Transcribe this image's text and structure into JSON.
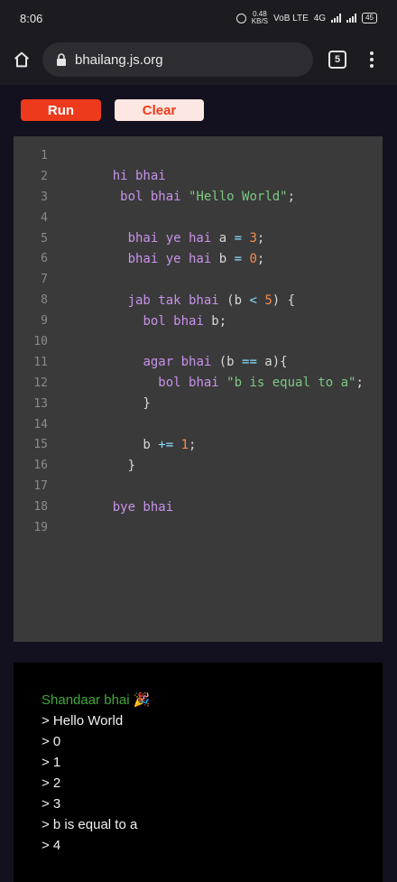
{
  "status_bar": {
    "time": "8:06",
    "speed_top": "0.48",
    "speed_bottom": "KB/S",
    "network_1": "VoB LTE",
    "network_2": "4G",
    "battery": "45"
  },
  "browser": {
    "url": "bhailang.js.org",
    "tab_count": "5"
  },
  "toolbar": {
    "run_label": "Run",
    "clear_label": "Clear"
  },
  "editor": {
    "line_numbers": [
      "1",
      "2",
      "3",
      "4",
      "5",
      "6",
      "7",
      "8",
      "9",
      "10",
      "11",
      "12",
      "13",
      "14",
      "15",
      "16",
      "17",
      "18",
      "19"
    ],
    "code_lines": [
      [],
      [
        {
          "t": "    "
        },
        {
          "t": "hi bhai",
          "c": "kw"
        }
      ],
      [
        {
          "t": "     "
        },
        {
          "t": "bol bhai",
          "c": "kw"
        },
        {
          "t": " "
        },
        {
          "t": "\"Hello World\"",
          "c": "str"
        },
        {
          "t": ";"
        }
      ],
      [],
      [
        {
          "t": "      "
        },
        {
          "t": "bhai ye hai",
          "c": "kw"
        },
        {
          "t": " a "
        },
        {
          "t": "=",
          "c": "op"
        },
        {
          "t": " "
        },
        {
          "t": "3",
          "c": "num"
        },
        {
          "t": ";"
        }
      ],
      [
        {
          "t": "      "
        },
        {
          "t": "bhai ye hai",
          "c": "kw"
        },
        {
          "t": " b "
        },
        {
          "t": "=",
          "c": "op"
        },
        {
          "t": " "
        },
        {
          "t": "0",
          "c": "num"
        },
        {
          "t": ";"
        }
      ],
      [],
      [
        {
          "t": "      "
        },
        {
          "t": "jab tak bhai",
          "c": "kw"
        },
        {
          "t": " (b "
        },
        {
          "t": "<",
          "c": "op"
        },
        {
          "t": " "
        },
        {
          "t": "5",
          "c": "num"
        },
        {
          "t": ") {"
        }
      ],
      [
        {
          "t": "        "
        },
        {
          "t": "bol bhai",
          "c": "kw"
        },
        {
          "t": " b;"
        }
      ],
      [],
      [
        {
          "t": "        "
        },
        {
          "t": "agar bhai",
          "c": "kw"
        },
        {
          "t": " (b "
        },
        {
          "t": "==",
          "c": "op"
        },
        {
          "t": " a){"
        }
      ],
      [
        {
          "t": "          "
        },
        {
          "t": "bol bhai",
          "c": "kw"
        },
        {
          "t": " "
        },
        {
          "t": "\"b is equal to a\"",
          "c": "str"
        },
        {
          "t": ";"
        }
      ],
      [
        {
          "t": "        }"
        }
      ],
      [],
      [
        {
          "t": "        b "
        },
        {
          "t": "+=",
          "c": "op"
        },
        {
          "t": " "
        },
        {
          "t": "1",
          "c": "num"
        },
        {
          "t": ";"
        }
      ],
      [
        {
          "t": "      }"
        }
      ],
      [],
      [
        {
          "t": "    "
        },
        {
          "t": "bye bhai",
          "c": "kw"
        }
      ],
      []
    ]
  },
  "output": {
    "success_message": "Shandaar bhai 🎉",
    "lines": [
      "> Hello World",
      "> 0",
      "> 1",
      "> 2",
      "> 3",
      "> b is equal to a",
      "> 4"
    ]
  }
}
